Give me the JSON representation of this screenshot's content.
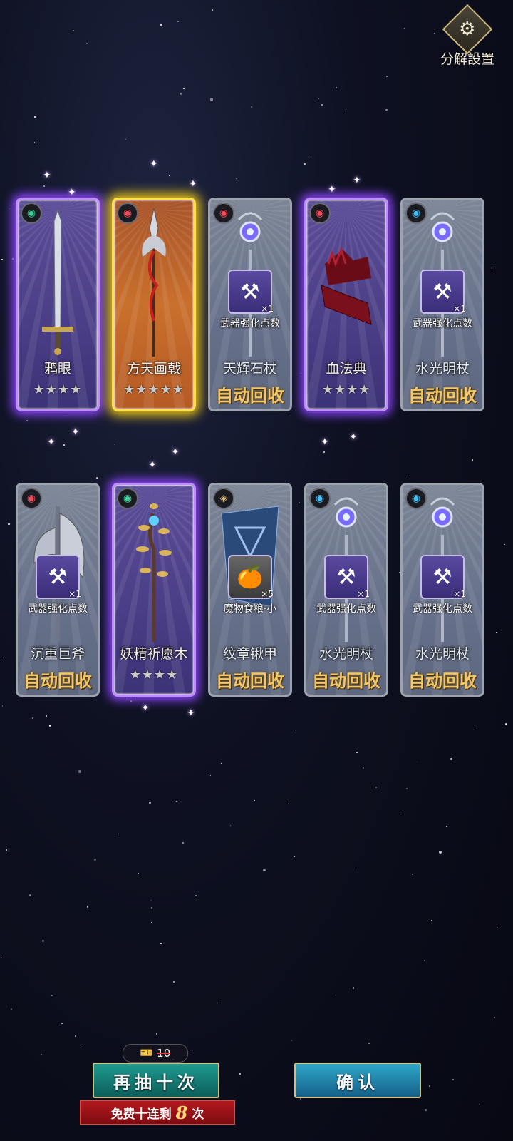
{
  "settings": {
    "label": "分解設置",
    "icon": "gear-icon"
  },
  "cards": [
    {
      "name": "鸦眼",
      "rarity": "purple",
      "element": "wind",
      "element_icon": "◉",
      "weapon_icon": "sword",
      "stars": "★★★★",
      "auto": "",
      "reward": null
    },
    {
      "name": "方天画戟",
      "rarity": "gold",
      "element": "fire",
      "element_icon": "◉",
      "weapon_icon": "halberd",
      "stars": "★★★★★",
      "auto": "",
      "reward": null
    },
    {
      "name": "天辉石杖",
      "rarity": "grey",
      "element": "fire",
      "element_icon": "◉",
      "weapon_icon": "staff",
      "stars": "",
      "auto": "自动回收",
      "reward": {
        "name": "武器强化点数",
        "qty": "×1",
        "icon": "anvil"
      }
    },
    {
      "name": "血法典",
      "rarity": "purple",
      "element": "fire",
      "element_icon": "◉",
      "weapon_icon": "tome",
      "stars": "★★★★",
      "auto": "",
      "reward": null
    },
    {
      "name": "水光明杖",
      "rarity": "grey",
      "element": "water",
      "element_icon": "◉",
      "weapon_icon": "staff",
      "stars": "",
      "auto": "自动回收",
      "reward": {
        "name": "武器强化点数",
        "qty": "×1",
        "icon": "anvil"
      }
    },
    {
      "name": "沉重巨斧",
      "rarity": "grey",
      "element": "fire",
      "element_icon": "◉",
      "weapon_icon": "axe",
      "stars": "",
      "auto": "自动回收",
      "reward": {
        "name": "武器强化点数",
        "qty": "×1",
        "icon": "anvil"
      }
    },
    {
      "name": "妖精祈愿木",
      "rarity": "purple",
      "element": "wind",
      "element_icon": "◉",
      "weapon_icon": "branch",
      "stars": "★★★★",
      "auto": "",
      "reward": null
    },
    {
      "name": "纹章锹甲",
      "rarity": "grey",
      "element": "earth",
      "element_icon": "◈",
      "weapon_icon": "shield",
      "stars": "",
      "auto": "自动回收",
      "reward": {
        "name": "魔物食粮·小",
        "qty": "×5",
        "icon": "food"
      }
    },
    {
      "name": "水光明杖",
      "rarity": "grey",
      "element": "water",
      "element_icon": "◉",
      "weapon_icon": "staff",
      "stars": "",
      "auto": "自动回收",
      "reward": {
        "name": "武器强化点数",
        "qty": "×1",
        "icon": "anvil"
      }
    },
    {
      "name": "水光明杖",
      "rarity": "grey",
      "element": "water",
      "element_icon": "◉",
      "weapon_icon": "staff",
      "stars": "",
      "auto": "自动回收",
      "reward": {
        "name": "武器强化点数",
        "qty": "×1",
        "icon": "anvil"
      }
    }
  ],
  "cost": {
    "amount": "10",
    "icon": "ticket-icon"
  },
  "buttons": {
    "redraw": "再抽十次",
    "confirm": "确认"
  },
  "free": {
    "prefix": "免费十连剩",
    "count": "8",
    "suffix": "次"
  }
}
